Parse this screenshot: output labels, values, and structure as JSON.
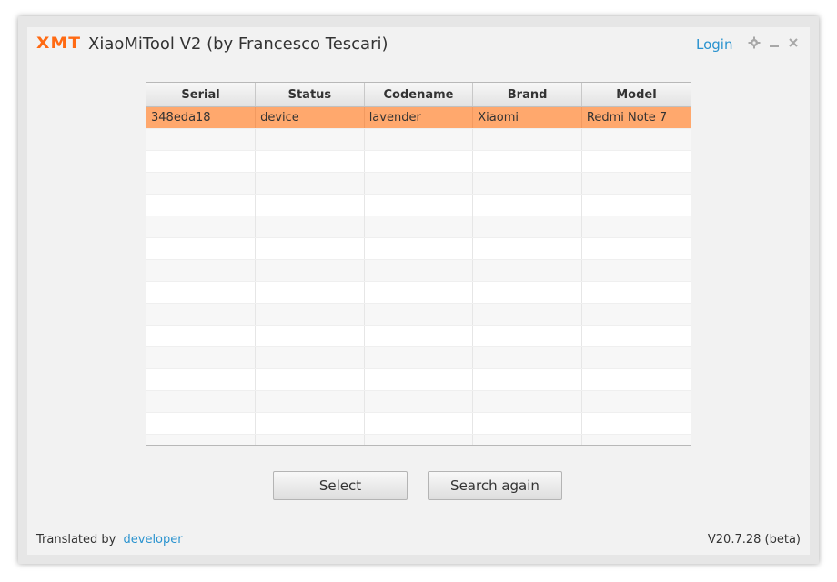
{
  "app": {
    "logo_text": "XMT",
    "title": "XiaoMiTool V2 (by Francesco Tescari)",
    "login_label": "Login",
    "accent_color": "#ff6a13",
    "link_color": "#2a93cf",
    "selected_row_color": "#ffa86d",
    "icons": [
      "gear-icon",
      "minimize-icon",
      "close-icon"
    ]
  },
  "table": {
    "columns": [
      "Serial",
      "Status",
      "Codename",
      "Brand",
      "Model"
    ],
    "rows": [
      [
        "348eda18",
        "device",
        "lavender",
        "Xiaomi",
        "Redmi Note 7"
      ]
    ],
    "selected_row": 0
  },
  "buttons": {
    "select_label": "Select",
    "search_again_label": "Search again"
  },
  "footer": {
    "translated_by_label": "Translated by",
    "translator_link": "developer",
    "version": "V20.7.28 (beta)"
  }
}
